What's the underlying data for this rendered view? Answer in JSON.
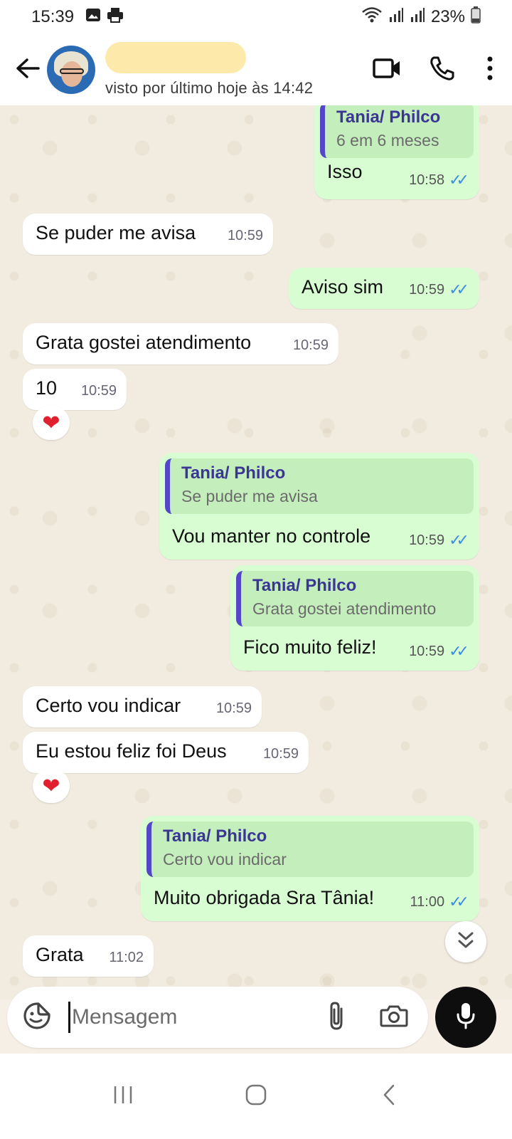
{
  "status_bar": {
    "time": "15:39",
    "battery": "23%",
    "icons": [
      "image-icon",
      "print-icon",
      "wifi-icon",
      "signal-icon",
      "signal-icon",
      "battery-icon"
    ]
  },
  "header": {
    "contact_name": "",
    "last_seen": "visto por último hoje às 14:42",
    "icons": [
      "back-arrow-icon",
      "video-call-icon",
      "phone-icon",
      "more-vert-icon"
    ]
  },
  "messages": [
    {
      "dir": "out",
      "quote_author": "Tania/ Philco",
      "quote_text": "6 em 6 meses",
      "text": "Isso",
      "time": "10:58",
      "read": true
    },
    {
      "dir": "in",
      "text": "Se puder me avisa",
      "time": "10:59"
    },
    {
      "dir": "out",
      "text": "Aviso sim",
      "time": "10:59",
      "read": true
    },
    {
      "dir": "in",
      "text": "Grata gostei atendimento",
      "time": "10:59"
    },
    {
      "dir": "in",
      "text": "10",
      "time": "10:59",
      "reaction": "❤"
    },
    {
      "dir": "out",
      "quote_author": "Tania/ Philco",
      "quote_text": "Se puder me avisa",
      "text": "Vou manter no controle",
      "time": "10:59",
      "read": true
    },
    {
      "dir": "out",
      "quote_author": "Tania/ Philco",
      "quote_text": "Grata gostei atendimento",
      "text": "Fico muito feliz!",
      "time": "10:59",
      "read": true
    },
    {
      "dir": "in",
      "text": "Certo vou indicar",
      "time": "10:59"
    },
    {
      "dir": "in",
      "text": "Eu estou feliz foi Deus",
      "time": "10:59",
      "reaction": "❤"
    },
    {
      "dir": "out",
      "quote_author": "Tania/ Philco",
      "quote_text": "Certo vou indicar",
      "text": "Muito obrigada Sra Tânia!",
      "time": "11:00",
      "read": true
    },
    {
      "dir": "in",
      "text": "Grata",
      "time": "11:02"
    }
  ],
  "composer": {
    "placeholder": "Mensagem",
    "value": ""
  },
  "colors": {
    "incoming_bubble": "#ffffff",
    "outgoing_bubble": "#d9fdd3",
    "quote_bar": "#5446c8",
    "read_ticks": "#3b8fe2",
    "reaction": "#e0202e"
  }
}
